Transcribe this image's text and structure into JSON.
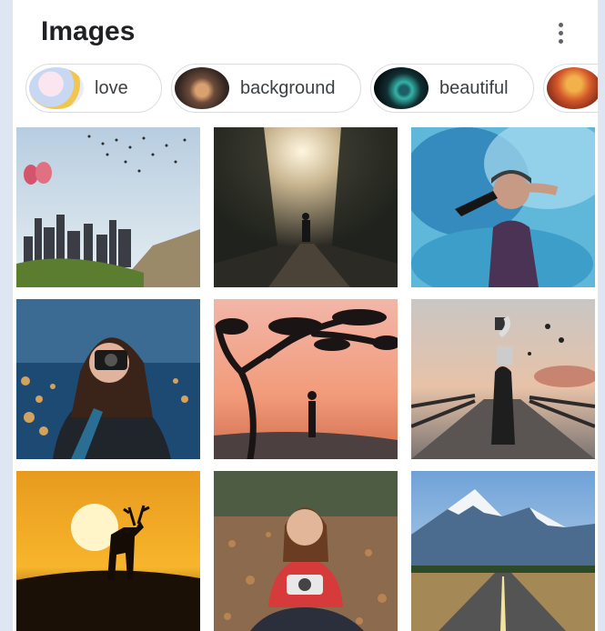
{
  "header": {
    "title": "Images",
    "more_icon": "more-vert-icon"
  },
  "chips": [
    {
      "label": "love",
      "thumb": "love-thumbnail"
    },
    {
      "label": "background",
      "thumb": "forest-path-thumbnail"
    },
    {
      "label": "beautiful",
      "thumb": "peacock-feather-thumbnail"
    },
    {
      "label": "",
      "thumb": "autumn-thumbnail"
    }
  ],
  "colors": {
    "page_bg": "#dde6f1",
    "card_bg": "#ffffff",
    "title": "#202124",
    "chip_border": "#dadce0",
    "chip_text": "#3c4043"
  },
  "images": [
    "city-skyline-with-balloons-and-birds",
    "person-in-foggy-forest-road",
    "woman-with-blue-smoke-flare",
    "woman-with-camera-city-bokeh",
    "silhouette-under-tree-at-sunset",
    "man-with-smoke-on-pier",
    "deer-silhouette-at-sunset",
    "woman-with-camera-sitting-in-leaves",
    "mountain-road-landscape"
  ]
}
